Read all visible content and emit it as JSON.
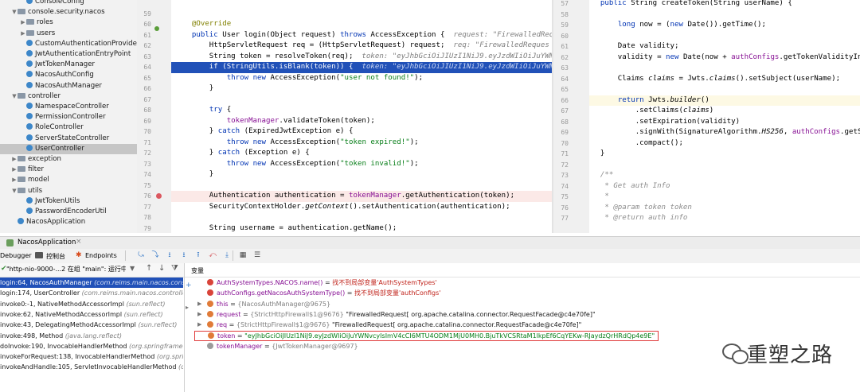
{
  "tree": {
    "items": [
      {
        "label": "ConsoleConfig",
        "indent": 3,
        "arrow": "",
        "kind": "cls"
      },
      {
        "label": "console.security.nacos",
        "indent": 2,
        "arrow": "▼",
        "kind": "pkg"
      },
      {
        "label": "roles",
        "indent": 3,
        "arrow": "▶",
        "kind": "pkg"
      },
      {
        "label": "users",
        "indent": 3,
        "arrow": "▶",
        "kind": "pkg"
      },
      {
        "label": "CustomAuthenticationProvider",
        "indent": 3,
        "arrow": "",
        "kind": "cls"
      },
      {
        "label": "JwtAuthenticationEntryPoint",
        "indent": 3,
        "arrow": "",
        "kind": "cls"
      },
      {
        "label": "JwtTokenManager",
        "indent": 3,
        "arrow": "",
        "kind": "cls"
      },
      {
        "label": "NacosAuthConfig",
        "indent": 3,
        "arrow": "",
        "kind": "cls"
      },
      {
        "label": "NacosAuthManager",
        "indent": 3,
        "arrow": "",
        "kind": "cls"
      },
      {
        "label": "controller",
        "indent": 2,
        "arrow": "▼",
        "kind": "pkg"
      },
      {
        "label": "NamespaceController",
        "indent": 3,
        "arrow": "",
        "kind": "cls"
      },
      {
        "label": "PermissionController",
        "indent": 3,
        "arrow": "",
        "kind": "cls"
      },
      {
        "label": "RoleController",
        "indent": 3,
        "arrow": "",
        "kind": "cls"
      },
      {
        "label": "ServerStateController",
        "indent": 3,
        "arrow": "",
        "kind": "cls"
      },
      {
        "label": "UserController",
        "indent": 3,
        "arrow": "",
        "kind": "cls",
        "selected": true
      },
      {
        "label": "exception",
        "indent": 2,
        "arrow": "▶",
        "kind": "pkg"
      },
      {
        "label": "filter",
        "indent": 2,
        "arrow": "▶",
        "kind": "pkg"
      },
      {
        "label": "model",
        "indent": 2,
        "arrow": "▶",
        "kind": "pkg"
      },
      {
        "label": "utils",
        "indent": 2,
        "arrow": "▼",
        "kind": "pkg"
      },
      {
        "label": "JwtTokenUtils",
        "indent": 3,
        "arrow": "",
        "kind": "cls"
      },
      {
        "label": "PasswordEncoderUtil",
        "indent": 3,
        "arrow": "",
        "kind": "cls"
      },
      {
        "label": "NacosApplication",
        "indent": 2,
        "arrow": "",
        "kind": "cls"
      }
    ]
  },
  "left_editor": {
    "line_numbers": [
      "59",
      "60",
      "61",
      "62",
      "63",
      "64",
      "65",
      "66",
      "67",
      "68",
      "69",
      "70",
      "71",
      "72",
      "73",
      "74",
      "75",
      "76",
      "77",
      "78",
      "79"
    ],
    "lines": [
      "",
      "    @Override",
      "    public User login(Object request) throws AccessException {",
      "        HttpServletRequest req = (HttpServletRequest) request;",
      "        String token = resolveToken(req);",
      "        if (StringUtils.isBlank(token)) {",
      "            throw new AccessException(\"user not found!\");",
      "        }",
      "",
      "        try {",
      "            tokenManager.validateToken(token);",
      "        } catch (ExpiredJwtException e) {",
      "            throw new AccessException(\"token expired!\");",
      "        } catch (Exception e) {",
      "            throw new AccessException(\"token invalid!\");",
      "        }",
      "",
      "        Authentication authentication = tokenManager.getAuthentication(token);",
      "        SecurityContextHolder.getContext().setAuthentication(authentication);",
      "",
      "        String username = authentication.getName();"
    ],
    "hint_61": "request: \"FirewalledReque",
    "hint_62": "req: \"FirewalledReques",
    "hint_63": "token: \"eyJhbGciOiJIUzI1NiJ9.eyJzdWIiOiJuYWNvcy",
    "hint_64": "token: \"eyJhbGciOiJIUzI1NiJ9.eyJzdWIiOiJuYWNvcy"
  },
  "right_editor": {
    "line_numbers": [
      "57",
      "58",
      "59",
      "60",
      "61",
      "62",
      "63",
      "64",
      "65",
      "66",
      "67",
      "68",
      "69",
      "70",
      "71",
      "72",
      "73",
      "74",
      "75",
      "76",
      "77"
    ],
    "lines": [
      "    public String createToken(String userName) {",
      "",
      "        long now = (new Date()).getTime();",
      "",
      "        Date validity;",
      "        validity = new Date(now + authConfigs.getTokenValidityIn",
      "",
      "        Claims claims = Jwts.claims().setSubject(userName);",
      "",
      "        return Jwts.builder()",
      "            .setClaims(claims)",
      "            .setExpiration(validity)",
      "            .signWith(SignatureAlgorithm.HS256, authConfigs.getS",
      "            .compact();",
      "    }",
      "",
      "    /**",
      "     * Get auth Info",
      "     *",
      "     * @param token token",
      "     * @return auth info"
    ]
  },
  "run_tab": {
    "label": "NacosApplication"
  },
  "debug_tabs": {
    "debugger": "Debugger",
    "console": "控制台",
    "endpoints": "Endpoints"
  },
  "thread_selector": {
    "value": "\"http-nio-9000-...2 在组 \"main\": 运行中"
  },
  "variables_header": "变量",
  "frames": [
    {
      "method": "login:64, NacosAuthManager",
      "cls": "(com.reims.main.nacos.console",
      "selected": true
    },
    {
      "method": "login:174, UserController",
      "cls": "(com.reims.main.nacos.controller)"
    },
    {
      "method": "invoke0:-1, NativeMethodAccessorImpl",
      "cls": "(sun.reflect)"
    },
    {
      "method": "invoke:62, NativeMethodAccessorImpl",
      "cls": "(sun.reflect)"
    },
    {
      "method": "invoke:43, DelegatingMethodAccessorImpl",
      "cls": "(sun.reflect)"
    },
    {
      "method": "invoke:498, Method",
      "cls": "(java.lang.reflect)"
    },
    {
      "method": "doInvoke:190, InvocableHandlerMethod",
      "cls": "(org.springframew"
    },
    {
      "method": "invokeForRequest:138, InvocableHandlerMethod",
      "cls": "(org.spring"
    },
    {
      "method": "invokeAndHandle:105, ServletInvocableHandlerMethod",
      "cls": "(org."
    }
  ],
  "variables": [
    {
      "name": "AuthSystemTypes.NACOS.name()",
      "sep": " = ",
      "value": "找不到局部变量'AuthSystemTypes'",
      "kind": "error"
    },
    {
      "name": "authConfigs.getNacosAuthSystemType()",
      "sep": " = ",
      "value": "找不到局部变量'authConfigs'",
      "kind": "error"
    },
    {
      "name": "this",
      "sep": " = ",
      "value": "{NacosAuthManager@9675}",
      "kind": "obj"
    },
    {
      "name": "request",
      "sep": " = ",
      "value": "{StrictHttpFirewall$1@9676} \"FirewalledRequest[ org.apache.catalina.connector.RequestFacade@c4e70fe]\"",
      "kind": "obj"
    },
    {
      "name": "req",
      "sep": " = ",
      "value": "{StrictHttpFirewall$1@9676} \"FirewalledRequest[ org.apache.catalina.connector.RequestFacade@c4e70fe]\"",
      "kind": "obj"
    },
    {
      "name": "token",
      "sep": " = ",
      "value": "\"eyJhbGciOiJIUzI1NiJ9.eyJzdWIiOiJuYWNvcyIsImV4cCI6MTU4ODM1MjU0MH0.BjuTkVCSRtaM1lkpEf6CqYEKw-RJaydzQrHRdQp4e9E\"",
      "kind": "str",
      "highlight": true
    },
    {
      "name": "tokenManager",
      "sep": " = ",
      "value": "{JwtTokenManager@9697}",
      "kind": "obj"
    }
  ],
  "watermark": {
    "text": "重塑之路"
  },
  "colors": {
    "selection": "#2151b8",
    "breakpoint": "#db5860",
    "string": "#067d17",
    "keyword": "#000080"
  }
}
